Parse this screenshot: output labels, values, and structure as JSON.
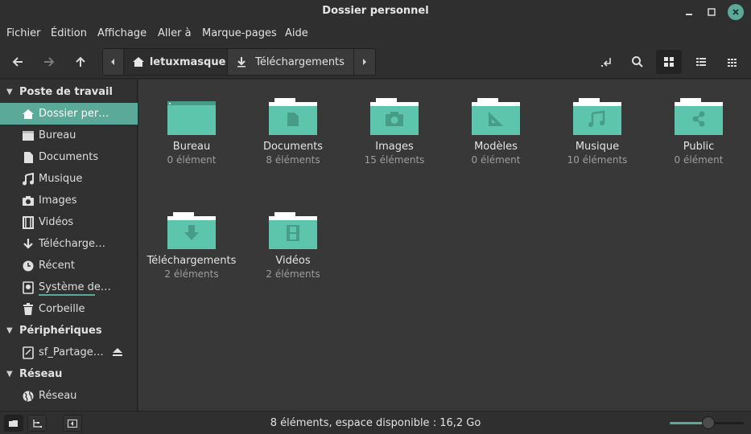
{
  "window": {
    "title": "Dossier personnel"
  },
  "menu": [
    "Fichier",
    "Édition",
    "Affichage",
    "Aller à",
    "Marque-pages",
    "Aide"
  ],
  "pathbar": {
    "home": "letuxmasque",
    "current": "Téléchargements"
  },
  "sidebar": {
    "sections": [
      {
        "label": "Poste de travail",
        "items": [
          {
            "label": "Dossier per…",
            "icon": "home-icon"
          },
          {
            "label": "Bureau",
            "icon": "desktop-icon"
          },
          {
            "label": "Documents",
            "icon": "document-icon"
          },
          {
            "label": "Musique",
            "icon": "music-icon"
          },
          {
            "label": "Images",
            "icon": "camera-icon"
          },
          {
            "label": "Vidéos",
            "icon": "film-icon"
          },
          {
            "label": "Télécharge…",
            "icon": "download-icon"
          },
          {
            "label": "Récent",
            "icon": "clock-icon"
          },
          {
            "label": "Système de…",
            "icon": "drive-icon"
          },
          {
            "label": "Corbeille",
            "icon": "trash-icon"
          }
        ]
      },
      {
        "label": "Périphériques",
        "items": [
          {
            "label": "sf_Partage…",
            "icon": "drive-icon"
          }
        ]
      },
      {
        "label": "Réseau",
        "items": [
          {
            "label": "Réseau",
            "icon": "globe-icon"
          }
        ]
      }
    ]
  },
  "files": [
    {
      "name": "Bureau",
      "count": "0 élément",
      "emblem": "desktop"
    },
    {
      "name": "Documents",
      "count": "8 éléments",
      "emblem": "document"
    },
    {
      "name": "Images",
      "count": "15 éléments",
      "emblem": "camera"
    },
    {
      "name": "Modèles",
      "count": "0 élément",
      "emblem": "template"
    },
    {
      "name": "Musique",
      "count": "10 éléments",
      "emblem": "music"
    },
    {
      "name": "Public",
      "count": "0 élément",
      "emblem": "share"
    },
    {
      "name": "Téléchargements",
      "count": "2 éléments",
      "emblem": "download"
    },
    {
      "name": "Vidéos",
      "count": "2 éléments",
      "emblem": "film"
    }
  ],
  "status": {
    "text": "8 éléments, espace disponible : 16,2 Go",
    "zoom_level": 0.52
  },
  "colors": {
    "accent": "#5aa999",
    "folder": "#5cc5ac",
    "folder_dark": "#479c88"
  }
}
